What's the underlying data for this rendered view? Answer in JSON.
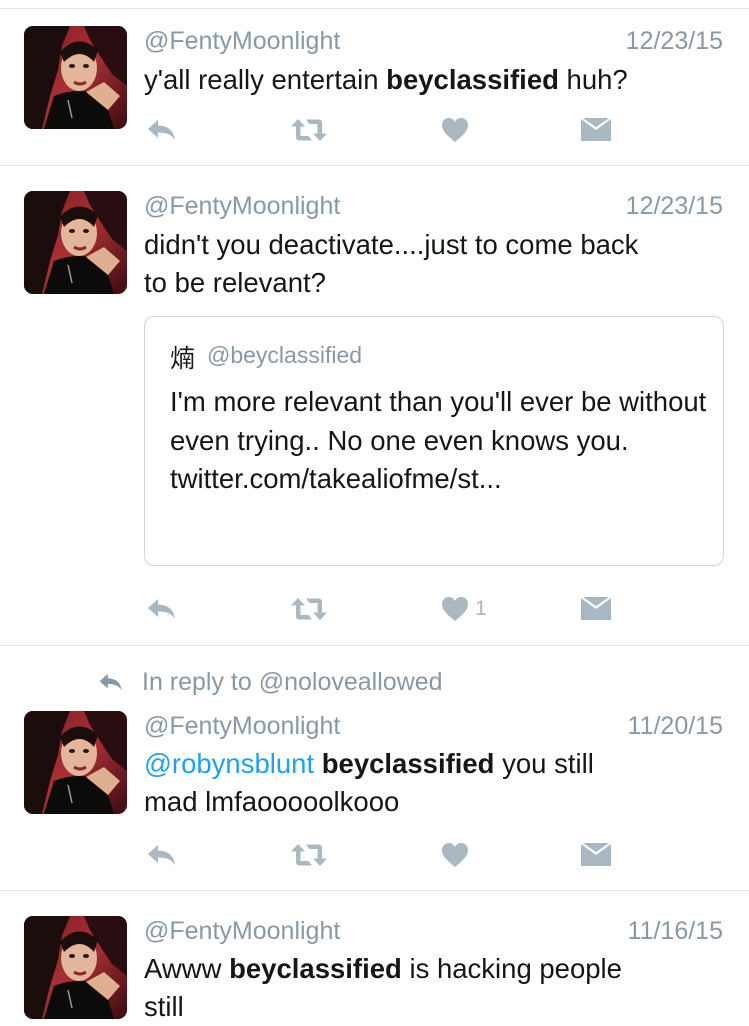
{
  "colors": {
    "text": "#14171a",
    "muted": "#8899a6",
    "icon": "#aab8c2",
    "link": "#1da1f2",
    "divider": "#e1e8ed",
    "quote_border": "#ccd6dd"
  },
  "icons": {
    "reply": "reply-icon",
    "retweet": "retweet-icon",
    "like": "heart-icon",
    "dm": "envelope-icon",
    "in_reply_to": "reply-arrow-icon"
  },
  "tweets": [
    {
      "handle": "@FentyMoonlight",
      "time": "12/23/15",
      "text": {
        "p1": "y'all really entertain ",
        "b1": "beyclassified",
        "p2": " huh?"
      },
      "like_count": ""
    },
    {
      "handle": "@FentyMoonlight",
      "time": "12/23/15",
      "text": {
        "line1": "didn't you deactivate....just to come back",
        "line2": "to be relevant?"
      },
      "quote": {
        "name": "煵",
        "handle": "@beyclassified",
        "text": "I'm more relevant than you'll ever be without even trying.. No one even knows you.  twitter.com/takealiofme/st..."
      },
      "like_count": "1"
    },
    {
      "in_reply_to": "In reply to @noloveallowed",
      "handle": "@FentyMoonlight",
      "time": "11/20/15",
      "text": {
        "mention": "@robynsblunt",
        "b1": "beyclassified",
        "p1": " you still",
        "line2": "mad lmfaooooolkooo"
      },
      "like_count": ""
    },
    {
      "handle": "@FentyMoonlight",
      "time": "11/16/15",
      "text": {
        "p1": "Awww ",
        "b1": "beyclassified",
        "p2": " is hacking people",
        "line2": "still"
      }
    }
  ]
}
